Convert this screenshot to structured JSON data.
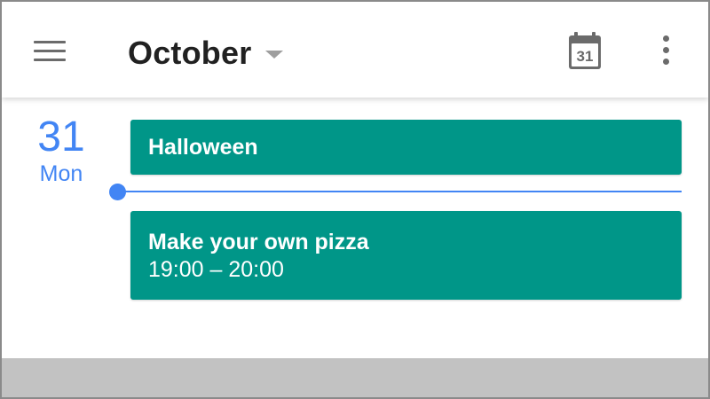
{
  "header": {
    "title": "October",
    "today_icon_day": "31"
  },
  "icons": {
    "menu": "hamburger-menu-icon",
    "dropdown": "caret-down-icon",
    "today": "calendar-today-icon",
    "more": "more-vertical-icon"
  },
  "day": {
    "number": "31",
    "weekday": "Mon"
  },
  "events": [
    {
      "title": "Halloween",
      "time": ""
    },
    {
      "title": "Make your own pizza",
      "time": "19:00 – 20:00"
    }
  ],
  "colors": {
    "accent": "#4285f4",
    "event": "#009688",
    "icon_gray": "#6b6b6b",
    "bottom_bar": "#c2c2c2"
  }
}
